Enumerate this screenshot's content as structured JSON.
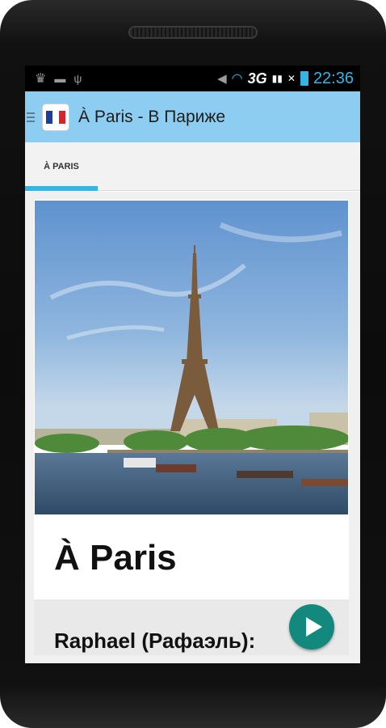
{
  "status_bar": {
    "time": "22:36",
    "network": "3G",
    "icons": [
      "crown-icon",
      "game-controller-icon",
      "usb-icon",
      "mute-icon",
      "wifi-icon",
      "signal-icon",
      "no-signal-icon",
      "battery-icon"
    ]
  },
  "action_bar": {
    "title": "À Paris - В Париже",
    "icons": [
      "menu-icon",
      "french-flag-icon"
    ]
  },
  "tabs": [
    {
      "label": "À PARIS",
      "selected": true
    }
  ],
  "content": {
    "image": "eiffel-tower-photo",
    "heading": "À Paris",
    "speaker": "Raphael (Рафаэль):",
    "play_icon": "play-icon"
  },
  "colors": {
    "action_bar": "#8ecdf2",
    "tab_indicator": "#33b5e5",
    "play_button": "#13897d",
    "time_text": "#33b5e5"
  }
}
